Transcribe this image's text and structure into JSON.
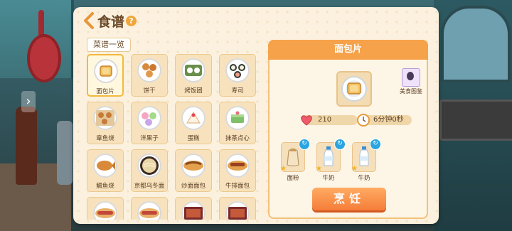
{
  "header": {
    "title": "食谱",
    "help_symbol": "?"
  },
  "list_tab": "菜谱一览",
  "recipes": [
    {
      "label": "面包片",
      "icon": "toast-icon",
      "selected": true
    },
    {
      "label": "饼干",
      "icon": "cookies-icon"
    },
    {
      "label": "烤饭团",
      "icon": "rice-ball-icon"
    },
    {
      "label": "寿司",
      "icon": "sushi-icon"
    },
    {
      "label": "章鱼烧",
      "icon": "takoyaki-icon"
    },
    {
      "label": "洋果子",
      "icon": "macaron-icon"
    },
    {
      "label": "蛋糕",
      "icon": "cake-icon"
    },
    {
      "label": "抹茶点心",
      "icon": "matcha-sweet-icon"
    },
    {
      "label": "鲷鱼烧",
      "icon": "taiyaki-icon"
    },
    {
      "label": "京都乌冬面",
      "icon": "udon-icon"
    },
    {
      "label": "炒面面包",
      "icon": "yakisoba-bread-icon"
    },
    {
      "label": "牛排面包",
      "icon": "steak-bread-icon"
    },
    {
      "label": "",
      "icon": "hotdog-icon"
    },
    {
      "label": "",
      "icon": "hotdog-icon"
    },
    {
      "label": "",
      "icon": "bento-icon"
    },
    {
      "label": "",
      "icon": "bento-icon"
    }
  ],
  "detail": {
    "title": "面包片",
    "encyclopedia_label": "美食图鉴",
    "heart_value": "210",
    "time_value": "6分钟0秒",
    "ingredients": [
      {
        "label": "面粉",
        "icon": "flour-sack-icon"
      },
      {
        "label": "牛奶",
        "icon": "milk-bottle-icon"
      },
      {
        "label": "牛奶",
        "icon": "milk-bottle-icon"
      }
    ],
    "cook_label": "烹饪"
  }
}
